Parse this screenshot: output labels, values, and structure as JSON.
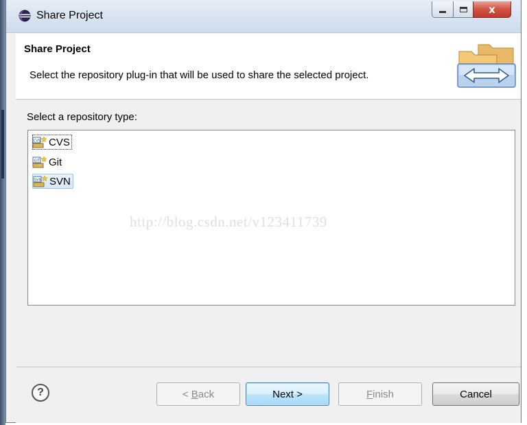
{
  "window": {
    "title": "Share Project",
    "close_glyph": "x"
  },
  "banner": {
    "title": "Share Project",
    "description": "Select the repository plug-in that will be used to share the selected project."
  },
  "content": {
    "section_label": "Select a repository type:",
    "repository_types": [
      {
        "label": "CVS",
        "icon": "cvs-repo-icon",
        "state": "focused"
      },
      {
        "label": "Git",
        "icon": "git-repo-icon",
        "state": "normal"
      },
      {
        "label": "SVN",
        "icon": "svn-repo-icon",
        "state": "selected"
      }
    ],
    "watermark": "http://blog.csdn.net/v123411739"
  },
  "buttons": {
    "help": "?",
    "back_prefix": "< ",
    "back_mnemonic": "B",
    "back_rest": "ack",
    "next": "Next >",
    "finish_mnemonic": "F",
    "finish_rest": "inish",
    "cancel": "Cancel"
  },
  "colors": {
    "accent": "#3c7fb1",
    "selection": "#d7e8f9",
    "close_button": "#c0392b"
  }
}
